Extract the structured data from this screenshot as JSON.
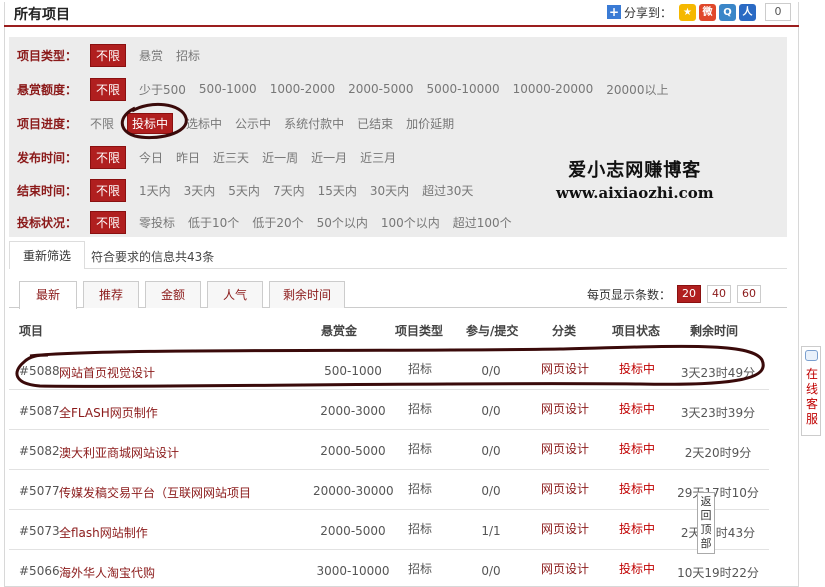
{
  "header": {
    "title": "所有项目",
    "share_label": "分享到：",
    "share_count": "0",
    "share_icons": [
      {
        "name": "qzone-icon",
        "color": "#f5b800",
        "glyph": "★"
      },
      {
        "name": "sina-weibo-icon",
        "color": "#e0482a",
        "glyph": "微"
      },
      {
        "name": "tencent-weibo-icon",
        "color": "#3a86c8",
        "glyph": "Q"
      },
      {
        "name": "renren-icon",
        "color": "#2a6ac4",
        "glyph": "人"
      }
    ]
  },
  "filters": [
    {
      "label": "项目类型：",
      "options": [
        "不限",
        "悬赏",
        "招标"
      ],
      "selected": 0
    },
    {
      "label": "悬赏额度：",
      "options": [
        "不限",
        "少于500",
        "500-1000",
        "1000-2000",
        "2000-5000",
        "5000-10000",
        "10000-20000",
        "20000以上"
      ],
      "selected": 0
    },
    {
      "label": "项目进度：",
      "options": [
        "不限",
        "投标中",
        "选标中",
        "公示中",
        "系统付款中",
        "已结束",
        "加价延期"
      ],
      "selected": 1
    },
    {
      "label": "发布时间：",
      "options": [
        "不限",
        "今日",
        "昨日",
        "近三天",
        "近一周",
        "近一月",
        "近三月"
      ],
      "selected": 0
    },
    {
      "label": "结束时间：",
      "options": [
        "不限",
        "1天内",
        "3天内",
        "5天内",
        "7天内",
        "15天内",
        "30天内",
        "超过30天"
      ],
      "selected": 0
    },
    {
      "label": "投标状况：",
      "options": [
        "不限",
        "零投标",
        "低于10个",
        "低于20个",
        "50个以内",
        "100个以内",
        "超过100个"
      ],
      "selected": 0
    }
  ],
  "watermark": {
    "cn": "爱小志网赚博客",
    "en": "www.aixiaozhi.com"
  },
  "refilter": {
    "button": "重新筛选",
    "message": "符合要求的信息共43条"
  },
  "tabs": [
    "最新",
    "推荐",
    "金额",
    "人气",
    "剩余时间"
  ],
  "per_page": {
    "label": "每页显示条数：",
    "options": [
      "20",
      "40",
      "60"
    ],
    "selected": 0
  },
  "columns": [
    "项目",
    "悬赏金",
    "项目类型",
    "参与/提交",
    "分类",
    "项目状态",
    "剩余时间"
  ],
  "rows": [
    {
      "id": "#5088",
      "name": "网站首页视觉设计",
      "reward": "500-1000",
      "type": "招标",
      "part": "0/0",
      "cat": "网页设计",
      "status": "投标中",
      "remain": "3天23时49分"
    },
    {
      "id": "#5087",
      "name": "全FLASH网页制作",
      "reward": "2000-3000",
      "type": "招标",
      "part": "0/0",
      "cat": "网页设计",
      "status": "投标中",
      "remain": "3天23时39分"
    },
    {
      "id": "#5082",
      "name": "澳大利亚商城网站设计",
      "reward": "2000-5000",
      "type": "招标",
      "part": "0/0",
      "cat": "网页设计",
      "status": "投标中",
      "remain": "2天20时9分"
    },
    {
      "id": "#5077",
      "name": "传媒发稿交易平台（互联网网站项目",
      "reward": "20000-30000",
      "type": "招标",
      "part": "0/0",
      "cat": "网页设计",
      "status": "投标中",
      "remain": "29天17时10分"
    },
    {
      "id": "#5073",
      "name": "全flash网站制作",
      "reward": "2000-5000",
      "type": "招标",
      "part": "1/1",
      "cat": "网页设计",
      "status": "投标中",
      "remain": "2天17时43分"
    },
    {
      "id": "#5066",
      "name": "海外华人淘宝代购",
      "reward": "3000-10000",
      "type": "招标",
      "part": "0/0",
      "cat": "网页设计",
      "status": "投标中",
      "remain": "10天19时22分"
    }
  ],
  "side": {
    "service": "在线客服",
    "back_top": "返回顶部"
  }
}
